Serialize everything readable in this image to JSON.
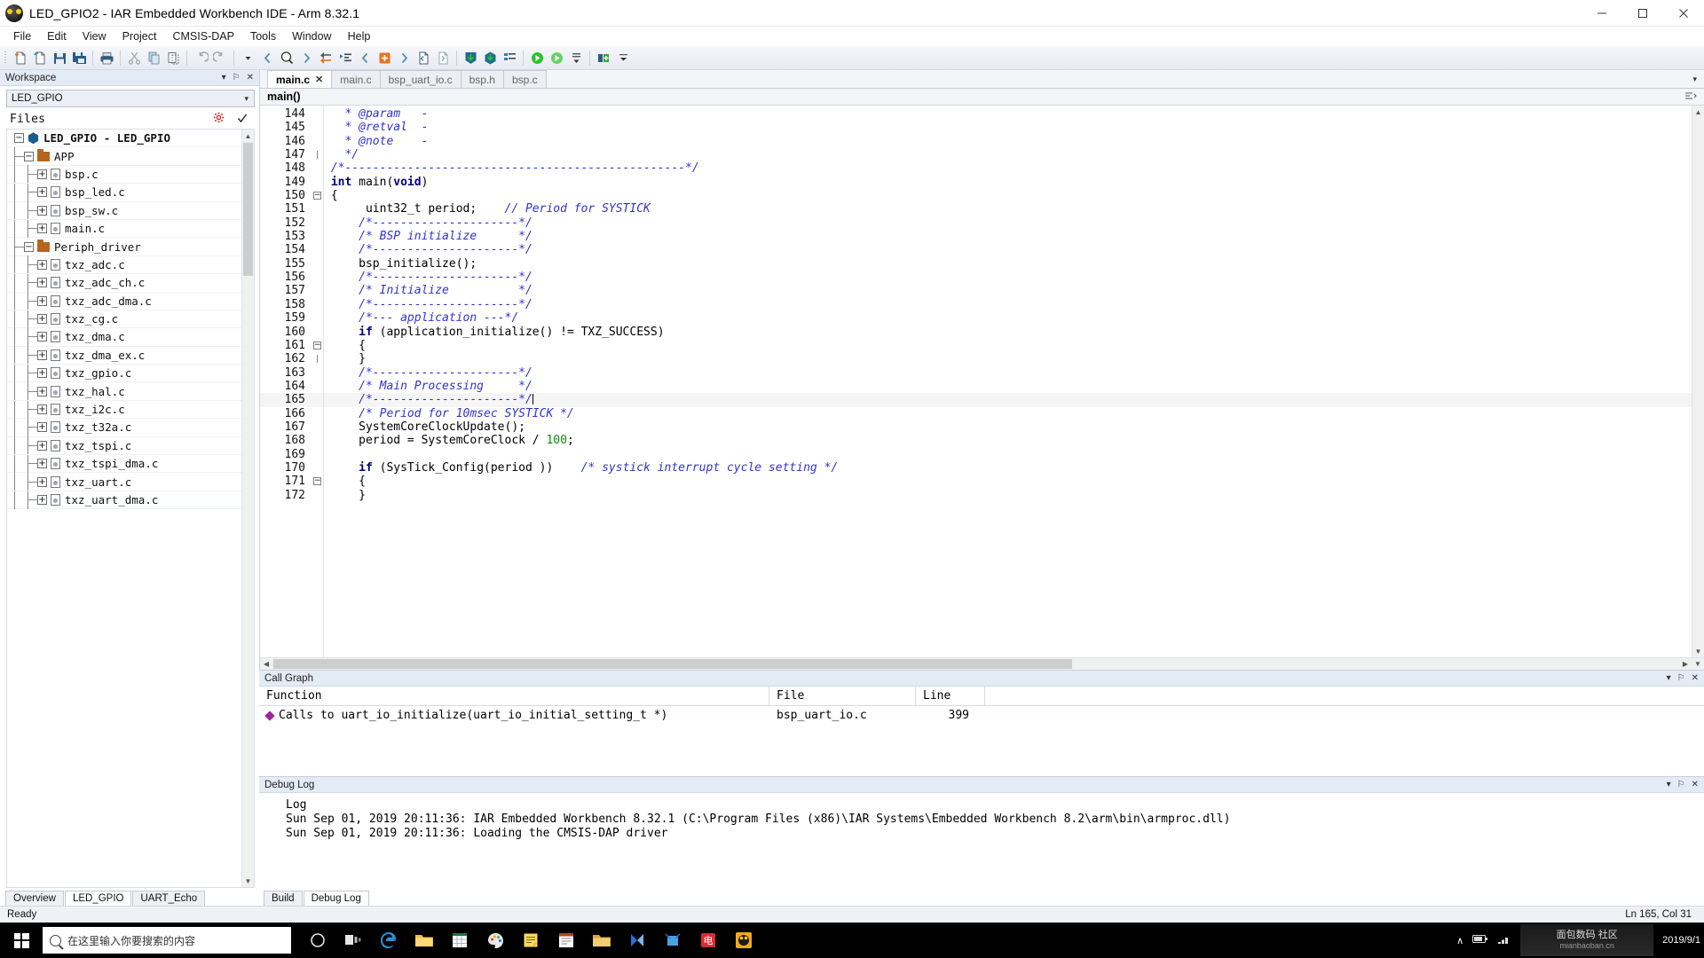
{
  "window": {
    "title": "LED_GPIO2 - IAR Embedded Workbench IDE - Arm 8.32.1",
    "app_icon": "iar-bug-icon",
    "minimize_label": "─",
    "maximize_label": "□",
    "close_label": "✕"
  },
  "menu": {
    "items": [
      {
        "label": "File"
      },
      {
        "label": "Edit"
      },
      {
        "label": "View"
      },
      {
        "label": "Project"
      },
      {
        "label": "CMSIS-DAP"
      },
      {
        "label": "Tools"
      },
      {
        "label": "Window"
      },
      {
        "label": "Help"
      }
    ]
  },
  "toolbar": {
    "groups": [
      {
        "buttons": [
          {
            "name": "new-document-icon"
          },
          {
            "name": "new-workspace-icon"
          },
          {
            "name": "save-icon"
          },
          {
            "name": "save-all-icon"
          }
        ]
      },
      {
        "buttons": [
          {
            "name": "print-icon"
          }
        ]
      },
      {
        "buttons": [
          {
            "name": "cut-icon"
          },
          {
            "name": "copy-icon"
          },
          {
            "name": "paste-icon"
          }
        ]
      },
      {
        "buttons": [
          {
            "name": "undo-icon"
          },
          {
            "name": "redo-icon"
          }
        ]
      },
      {
        "buttons": [
          {
            "name": "search-dropdown-icon"
          },
          {
            "name": "navigate-back-icon"
          },
          {
            "name": "find-icon"
          },
          {
            "name": "navigate-forward-icon"
          },
          {
            "name": "go-to-definition-icon"
          },
          {
            "name": "bookmark-list-icon"
          },
          {
            "name": "previous-bookmark-icon"
          },
          {
            "name": "toggle-bookmark-icon"
          },
          {
            "name": "next-bookmark-icon"
          }
        ]
      },
      {
        "buttons": [
          {
            "name": "compile-icon"
          },
          {
            "name": "make-icon"
          },
          {
            "name": "build-all-icon"
          },
          {
            "name": "stop-build-icon"
          },
          {
            "name": "toggle-breakpoint-icon"
          }
        ]
      },
      {
        "buttons": [
          {
            "name": "download-and-debug-icon"
          },
          {
            "name": "debug-without-download-icon"
          }
        ]
      },
      {
        "buttons": [
          {
            "name": "workspace-dropdown-icon"
          },
          {
            "name": "project-config-icon"
          }
        ]
      }
    ]
  },
  "workspace": {
    "caption": "Workspace",
    "caption_buttons": [
      {
        "name": "panel-menu-icon",
        "glyph": "▾"
      },
      {
        "name": "panel-pin-icon",
        "glyph": "⚐"
      },
      {
        "name": "panel-close-icon",
        "glyph": "✕"
      }
    ],
    "config_selected": "LED_GPIO",
    "files_header": "Files",
    "header_icons": [
      {
        "name": "settings-gear-icon"
      },
      {
        "name": "build-status-check-icon"
      }
    ],
    "tree": [
      {
        "label": "LED_GPIO - LED_GPIO",
        "depth": 0,
        "type": "project",
        "expander": "−",
        "bold": true
      },
      {
        "label": "APP",
        "depth": 1,
        "type": "folder",
        "expander": "−",
        "bold": false
      },
      {
        "label": "bsp.c",
        "depth": 2,
        "type": "file",
        "expander": "+",
        "bold": false
      },
      {
        "label": "bsp_led.c",
        "depth": 2,
        "type": "file",
        "expander": "+",
        "bold": false
      },
      {
        "label": "bsp_sw.c",
        "depth": 2,
        "type": "file",
        "expander": "+",
        "bold": false
      },
      {
        "label": "main.c",
        "depth": 2,
        "type": "file",
        "expander": "+",
        "bold": false
      },
      {
        "label": "Periph_driver",
        "depth": 1,
        "type": "folder",
        "expander": "−",
        "bold": false
      },
      {
        "label": "txz_adc.c",
        "depth": 2,
        "type": "file",
        "expander": "+",
        "bold": false
      },
      {
        "label": "txz_adc_ch.c",
        "depth": 2,
        "type": "file",
        "expander": "+",
        "bold": false
      },
      {
        "label": "txz_adc_dma.c",
        "depth": 2,
        "type": "file",
        "expander": "+",
        "bold": false
      },
      {
        "label": "txz_cg.c",
        "depth": 2,
        "type": "file",
        "expander": "+",
        "bold": false
      },
      {
        "label": "txz_dma.c",
        "depth": 2,
        "type": "file",
        "expander": "+",
        "bold": false
      },
      {
        "label": "txz_dma_ex.c",
        "depth": 2,
        "type": "file",
        "expander": "+",
        "bold": false
      },
      {
        "label": "txz_gpio.c",
        "depth": 2,
        "type": "file",
        "expander": "+",
        "bold": false
      },
      {
        "label": "txz_hal.c",
        "depth": 2,
        "type": "file",
        "expander": "+",
        "bold": false
      },
      {
        "label": "txz_i2c.c",
        "depth": 2,
        "type": "file",
        "expander": "+",
        "bold": false
      },
      {
        "label": "txz_t32a.c",
        "depth": 2,
        "type": "file",
        "expander": "+",
        "bold": false
      },
      {
        "label": "txz_tspi.c",
        "depth": 2,
        "type": "file",
        "expander": "+",
        "bold": false
      },
      {
        "label": "txz_tspi_dma.c",
        "depth": 2,
        "type": "file",
        "expander": "+",
        "bold": false
      },
      {
        "label": "txz_uart.c",
        "depth": 2,
        "type": "file",
        "expander": "+",
        "bold": false
      },
      {
        "label": "txz_uart_dma.c",
        "depth": 2,
        "type": "file",
        "expander": "+",
        "bold": false
      }
    ],
    "tabs": [
      {
        "label": "Overview",
        "active": false
      },
      {
        "label": "LED_GPIO",
        "active": true
      },
      {
        "label": "UART_Echo",
        "active": false
      }
    ]
  },
  "editor": {
    "tabs": [
      {
        "label": "main.c",
        "active": true,
        "close_glyph": "✕"
      },
      {
        "label": "main.c",
        "active": false
      },
      {
        "label": "bsp_uart_io.c",
        "active": false
      },
      {
        "label": "bsp.h",
        "active": false
      },
      {
        "label": "bsp.c",
        "active": false
      }
    ],
    "tab_overflow_glyph": "▾",
    "function_scope": "main()",
    "lines": [
      {
        "num": "144",
        "fold": "",
        "text": "   * @param   -",
        "style": "comment"
      },
      {
        "num": "145",
        "fold": "",
        "text": "   * @retval  -",
        "style": "comment"
      },
      {
        "num": "146",
        "fold": "",
        "text": "   * @note    -",
        "style": "comment"
      },
      {
        "num": "147",
        "fold": "end",
        "text": "   */",
        "style": "comment"
      },
      {
        "num": "148",
        "fold": "",
        "text": " /*-------------------------------------------------*/",
        "style": "comment"
      },
      {
        "num": "149",
        "fold": "",
        "text": " int main(void)",
        "style": "code_main"
      },
      {
        "num": "150",
        "fold": "box",
        "text": " {",
        "style": "plain"
      },
      {
        "num": "151",
        "fold": "",
        "text": "      uint32_t period;    // Period for SYSTICK",
        "style": "code_period"
      },
      {
        "num": "152",
        "fold": "",
        "text": "     /*---------------------*/",
        "style": "comment"
      },
      {
        "num": "153",
        "fold": "",
        "text": "     /* BSP initialize      */",
        "style": "comment"
      },
      {
        "num": "154",
        "fold": "",
        "text": "     /*---------------------*/",
        "style": "comment"
      },
      {
        "num": "155",
        "fold": "",
        "text": "     bsp_initialize();",
        "style": "plain"
      },
      {
        "num": "156",
        "fold": "",
        "text": "     /*---------------------*/",
        "style": "comment"
      },
      {
        "num": "157",
        "fold": "",
        "text": "     /* Initialize          */",
        "style": "comment"
      },
      {
        "num": "158",
        "fold": "",
        "text": "     /*---------------------*/",
        "style": "comment"
      },
      {
        "num": "159",
        "fold": "",
        "text": "     /*--- application ---*/",
        "style": "comment"
      },
      {
        "num": "160",
        "fold": "",
        "text": "     if (application_initialize() != TXZ_SUCCESS)",
        "style": "code_if_app"
      },
      {
        "num": "161",
        "fold": "box",
        "text": "     {",
        "style": "plain"
      },
      {
        "num": "162",
        "fold": "end",
        "text": "     }",
        "style": "plain"
      },
      {
        "num": "163",
        "fold": "",
        "text": "     /*---------------------*/",
        "style": "comment"
      },
      {
        "num": "164",
        "fold": "",
        "text": "     /* Main Processing     */",
        "style": "comment"
      },
      {
        "num": "165",
        "fold": "",
        "text": "     /*---------------------*/",
        "style": "comment",
        "current": true,
        "caret": true
      },
      {
        "num": "166",
        "fold": "",
        "text": "     /* Period for 10msec SYSTICK */",
        "style": "comment"
      },
      {
        "num": "167",
        "fold": "",
        "text": "     SystemCoreClockUpdate();",
        "style": "plain"
      },
      {
        "num": "168",
        "fold": "",
        "text": "     period = SystemCoreClock / 100;",
        "style": "code_period_assign"
      },
      {
        "num": "169",
        "fold": "",
        "text": "",
        "style": "plain"
      },
      {
        "num": "170",
        "fold": "",
        "text": "     if (SysTick_Config(period ))    /* systick interrupt cycle setting */",
        "style": "code_systick"
      },
      {
        "num": "171",
        "fold": "box",
        "text": "     {",
        "style": "plain"
      },
      {
        "num": "172",
        "fold": "",
        "text": "     }",
        "style": "plain"
      }
    ]
  },
  "call_graph": {
    "caption": "Call Graph",
    "caption_buttons": [
      {
        "name": "panel-menu-icon",
        "glyph": "▾"
      },
      {
        "name": "panel-pin-icon",
        "glyph": "⚐"
      },
      {
        "name": "panel-close-icon",
        "glyph": "✕"
      }
    ],
    "columns": [
      {
        "label": "Function"
      },
      {
        "label": "File"
      },
      {
        "label": "Line"
      }
    ],
    "rows": [
      {
        "function": "Calls to uart_io_initialize(uart_io_initial_setting_t *)",
        "file": "bsp_uart_io.c",
        "line": "399"
      }
    ]
  },
  "debug_log": {
    "caption": "Debug Log",
    "caption_buttons": [
      {
        "name": "panel-menu-icon",
        "glyph": "▾"
      },
      {
        "name": "panel-pin-icon",
        "glyph": "⚐"
      },
      {
        "name": "panel-close-icon",
        "glyph": "✕"
      }
    ],
    "header": "Log",
    "entries": [
      "Sun Sep 01, 2019 20:11:36: IAR Embedded Workbench 8.32.1 (C:\\Program Files (x86)\\IAR Systems\\Embedded Workbench 8.2\\arm\\bin\\armproc.dll)",
      "Sun Sep 01, 2019 20:11:36: Loading the CMSIS-DAP driver"
    ],
    "tabs": [
      {
        "label": "Build",
        "active": false
      },
      {
        "label": "Debug Log",
        "active": true
      }
    ]
  },
  "status_bar": {
    "message": "Ready",
    "cursor_position": "Ln 165, Col 31"
  },
  "taskbar": {
    "start_label": "start-button",
    "search_placeholder": "在这里输入你要搜索的内容",
    "pinned": [
      {
        "name": "cortana-icon"
      },
      {
        "name": "task-view-icon"
      },
      {
        "name": "edge-browser-icon"
      },
      {
        "name": "file-explorer-icon"
      },
      {
        "name": "excel-icon"
      },
      {
        "name": "palette-icon"
      },
      {
        "name": "sticky-notes-icon"
      },
      {
        "name": "word-icon"
      },
      {
        "name": "folder-icon"
      },
      {
        "name": "video-editor-icon"
      },
      {
        "name": "screenshot-icon"
      },
      {
        "name": "chinese-app-icon"
      },
      {
        "name": "iar-workbench-icon"
      }
    ],
    "tray": [
      {
        "name": "show-hidden-icons-chevron",
        "glyph": "∧"
      },
      {
        "name": "battery-icon",
        "glyph": "▮"
      },
      {
        "name": "network-icon",
        "glyph": "◰"
      }
    ],
    "watermark_line1": "面包数码 社区",
    "watermark_line2": "mianbaoban.cn",
    "date": "2019/9/1"
  },
  "colors": {
    "accent_blue": "#1b5e8c",
    "comment_blue": "#3333cc",
    "keyword_navy": "#000080",
    "number_green": "#118811",
    "folder_brown": "#b5651d",
    "diamond_magenta": "#a0229c",
    "caption_bg": "#e3ebf5"
  }
}
